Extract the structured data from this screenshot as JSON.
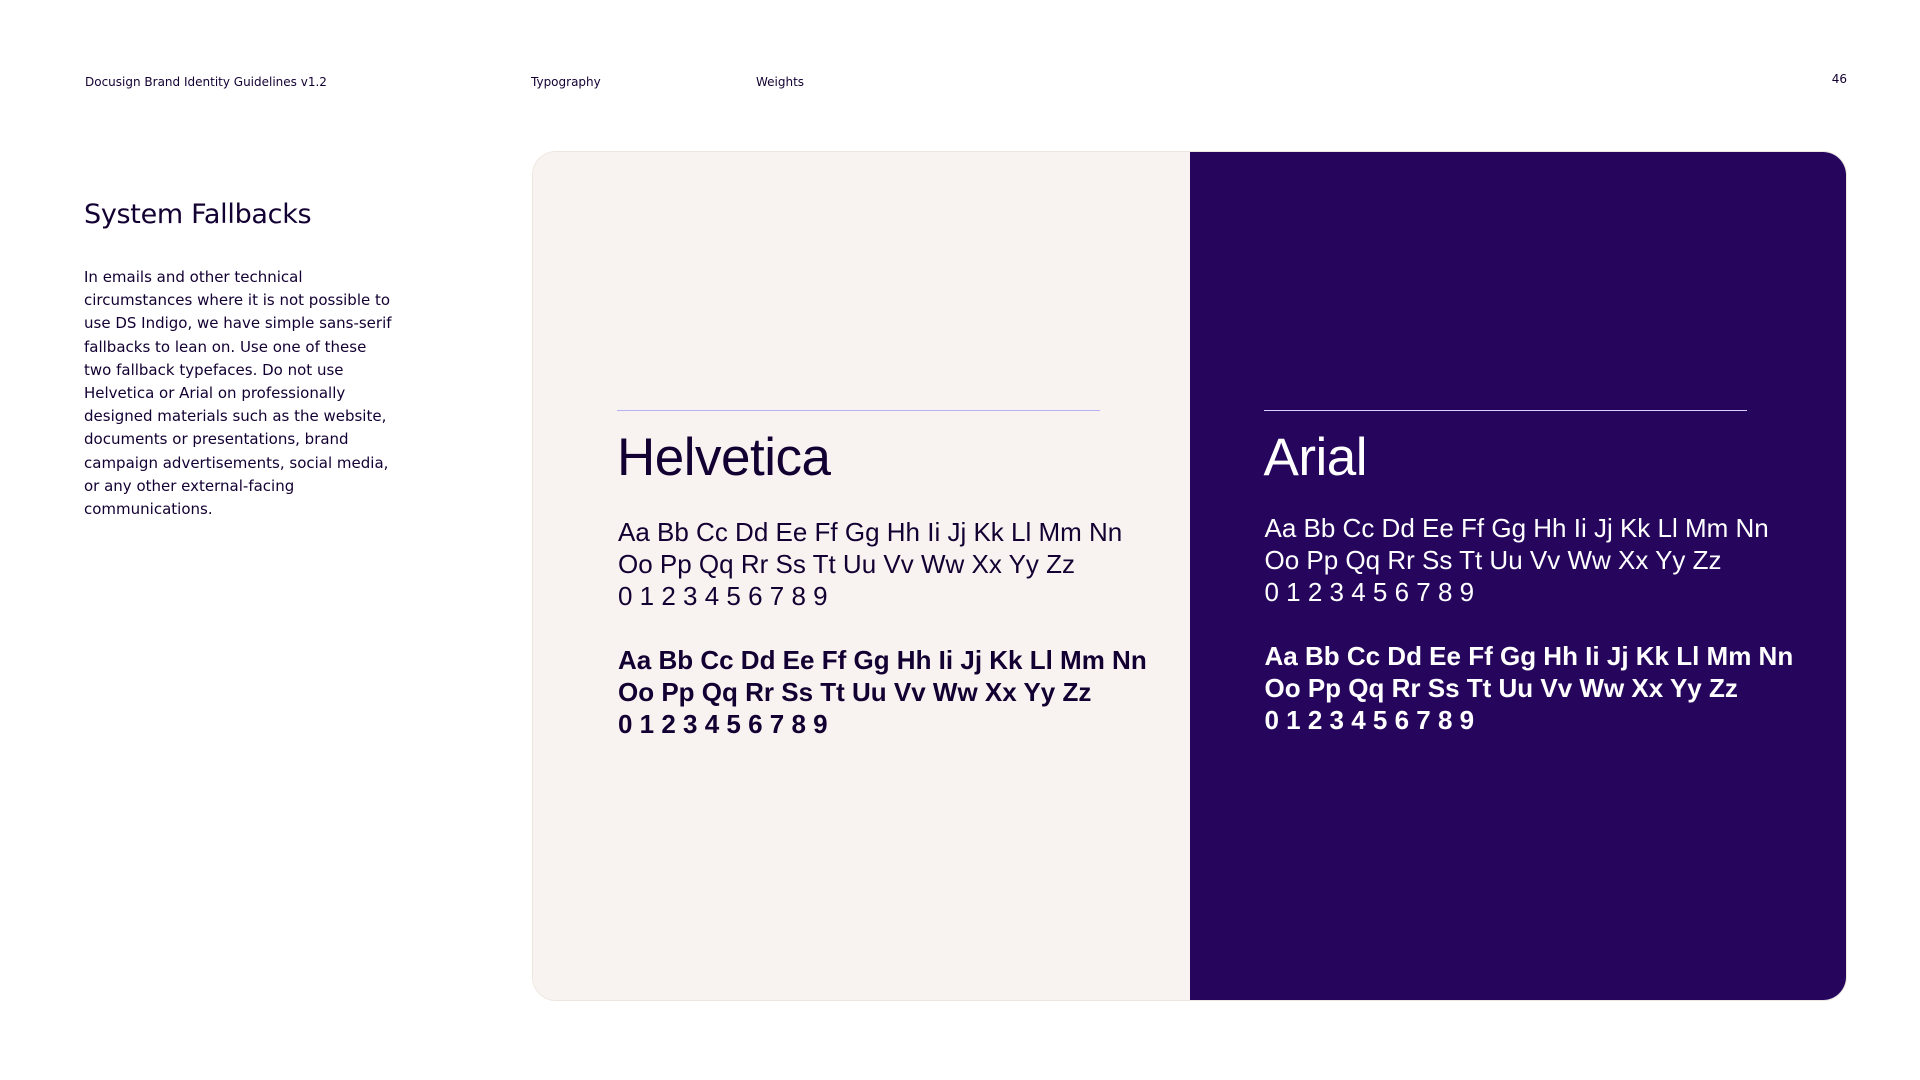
{
  "header": {
    "document_title": "Docusign Brand Identity Guidelines v1.2",
    "section": "Typography",
    "subsection": "Weights",
    "page_number": "46"
  },
  "intro": {
    "title": "System Fallbacks",
    "body": "In emails and other technical circumstances where it is not possible to use DS Indigo, we have simple sans-serif fallbacks to lean on. Use one of these two fallback typefaces. Do not use Helvetica or Arial on professionally designed materials such as the website, documents or presentations, brand campaign advertisements, social media, or any other external-facing communications."
  },
  "colors": {
    "light_panel": "#f8f3f0",
    "dark_panel": "#26065d",
    "ink": "#130032",
    "rule_light": "#b6b0f5"
  },
  "typefaces": [
    {
      "name": "Helvetica",
      "regular": {
        "line1": "Aa Bb Cc Dd Ee Ff Gg Hh Ii Jj Kk Ll Mm Nn",
        "line2": "Oo Pp Qq Rr Ss Tt Uu Vv Ww Xx Yy Zz",
        "line3": "0 1 2 3 4 5 6 7 8 9"
      },
      "bold": {
        "line1": "Aa Bb Cc Dd Ee Ff Gg Hh Ii Jj Kk Ll Mm Nn",
        "line2": "Oo Pp Qq Rr Ss Tt Uu Vv Ww Xx Yy Zz",
        "line3": "0 1 2 3 4 5 6 7 8 9"
      }
    },
    {
      "name": "Arial",
      "regular": {
        "line1": "Aa Bb Cc Dd Ee Ff Gg Hh Ii Jj Kk Ll Mm Nn",
        "line2": "Oo Pp Qq Rr Ss Tt Uu Vv Ww Xx Yy Zz",
        "line3": "0 1 2 3 4 5 6 7 8 9"
      },
      "bold": {
        "line1": "Aa Bb Cc Dd Ee Ff Gg Hh Ii Jj Kk Ll Mm Nn",
        "line2": "Oo Pp Qq Rr Ss Tt Uu Vv Ww Xx Yy Zz",
        "line3": "0 1 2 3 4 5 6 7 8 9"
      }
    }
  ]
}
